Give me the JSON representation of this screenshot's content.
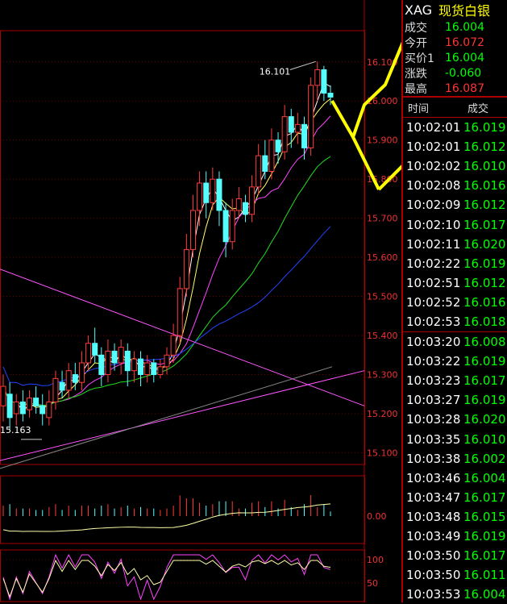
{
  "header": {
    "code": "XAG",
    "name": "现货白银"
  },
  "stats": [
    {
      "label": "成交",
      "value": "16.004",
      "color": "#00ff00"
    },
    {
      "label": "今开",
      "value": "16.072",
      "color": "#ff3333"
    },
    {
      "label": "买价1",
      "value": "16.004",
      "color": "#00ff00"
    },
    {
      "label": "涨跌",
      "value": "-0.060",
      "color": "#00ff00"
    },
    {
      "label": "最高",
      "value": "16.087",
      "color": "#ff3333"
    }
  ],
  "table": {
    "col_time": "时间",
    "col_price": "成交",
    "rows": [
      {
        "time": "10:02:01",
        "price": "16.019"
      },
      {
        "time": "10:02:01",
        "price": "16.012"
      },
      {
        "time": "10:02:02",
        "price": "16.010"
      },
      {
        "time": "10:02:08",
        "price": "16.016"
      },
      {
        "time": "10:02:09",
        "price": "16.012"
      },
      {
        "time": "10:02:10",
        "price": "16.017"
      },
      {
        "time": "10:02:11",
        "price": "16.020"
      },
      {
        "time": "10:02:22",
        "price": "16.019"
      },
      {
        "time": "10:02:51",
        "price": "16.012"
      },
      {
        "time": "10:02:52",
        "price": "16.016"
      },
      {
        "time": "10:02:53",
        "price": "16.018"
      },
      {
        "time": "10:03:20",
        "price": "16.008"
      },
      {
        "time": "10:03:22",
        "price": "16.019"
      },
      {
        "time": "10:03:23",
        "price": "16.017"
      },
      {
        "time": "10:03:27",
        "price": "16.019"
      },
      {
        "time": "10:03:28",
        "price": "16.020"
      },
      {
        "time": "10:03:35",
        "price": "16.010"
      },
      {
        "time": "10:03:38",
        "price": "16.002"
      },
      {
        "time": "10:03:46",
        "price": "16.004"
      },
      {
        "time": "10:03:47",
        "price": "16.017"
      },
      {
        "time": "10:03:48",
        "price": "16.015"
      },
      {
        "time": "10:03:49",
        "price": "16.019"
      },
      {
        "time": "10:03:50",
        "price": "16.017"
      },
      {
        "time": "10:03:50",
        "price": "16.011"
      },
      {
        "time": "10:03:53",
        "price": "16.004"
      }
    ]
  },
  "chart_data": {
    "type": "candlestick",
    "y_ticks": [
      "16.100",
      "16.000",
      "15.900",
      "15.800",
      "15.700",
      "15.600",
      "15.500",
      "15.400",
      "15.300",
      "15.200",
      "15.100"
    ],
    "ylim": [
      15.07,
      16.18
    ],
    "annotations": {
      "high": "16.101",
      "low": "15.163"
    },
    "candles": [
      [
        15.22,
        15.27,
        15.3,
        15.18
      ],
      [
        15.25,
        15.19,
        15.28,
        15.16
      ],
      [
        15.2,
        15.23,
        15.25,
        15.17
      ],
      [
        15.23,
        15.2,
        15.26,
        15.18
      ],
      [
        15.21,
        15.24,
        15.26,
        15.19
      ],
      [
        15.24,
        15.22,
        15.27,
        15.2
      ],
      [
        15.22,
        15.2,
        15.25,
        15.17
      ],
      [
        15.19,
        15.23,
        15.26,
        15.17
      ],
      [
        15.23,
        15.29,
        15.31,
        15.21
      ],
      [
        15.28,
        15.26,
        15.31,
        15.24
      ],
      [
        15.26,
        15.31,
        15.33,
        15.24
      ],
      [
        15.3,
        15.28,
        15.33,
        15.26
      ],
      [
        15.28,
        15.33,
        15.36,
        15.26
      ],
      [
        15.33,
        15.38,
        15.4,
        15.31
      ],
      [
        15.38,
        15.35,
        15.42,
        15.33
      ],
      [
        15.35,
        15.3,
        15.37,
        15.27
      ],
      [
        15.3,
        15.36,
        15.39,
        15.28
      ],
      [
        15.36,
        15.33,
        15.38,
        15.31
      ],
      [
        15.33,
        15.37,
        15.39,
        15.3
      ],
      [
        15.36,
        15.31,
        15.38,
        15.27
      ],
      [
        15.31,
        15.34,
        15.36,
        15.28
      ],
      [
        15.34,
        15.3,
        15.36,
        15.27
      ],
      [
        15.3,
        15.33,
        15.35,
        15.28
      ],
      [
        15.33,
        15.3,
        15.34,
        15.28
      ],
      [
        15.3,
        15.32,
        15.34,
        15.29
      ],
      [
        15.32,
        15.35,
        15.37,
        15.3
      ],
      [
        15.35,
        15.4,
        15.43,
        15.33
      ],
      [
        15.4,
        15.52,
        15.55,
        15.38
      ],
      [
        15.52,
        15.62,
        15.66,
        15.5
      ],
      [
        15.62,
        15.72,
        15.76,
        15.6
      ],
      [
        15.72,
        15.79,
        15.82,
        15.68
      ],
      [
        15.79,
        15.74,
        15.82,
        15.7
      ],
      [
        15.74,
        15.8,
        15.83,
        15.72
      ],
      [
        15.8,
        15.72,
        15.82,
        15.68
      ],
      [
        15.72,
        15.64,
        15.74,
        15.6
      ],
      [
        15.64,
        15.72,
        15.75,
        15.62
      ],
      [
        15.72,
        15.75,
        15.78,
        15.7
      ],
      [
        15.74,
        15.71,
        15.76,
        15.69
      ],
      [
        15.71,
        15.78,
        15.81,
        15.69
      ],
      [
        15.78,
        15.86,
        15.89,
        15.76
      ],
      [
        15.86,
        15.82,
        15.9,
        15.8
      ],
      [
        15.82,
        15.9,
        15.93,
        15.8
      ],
      [
        15.9,
        15.87,
        15.92,
        15.84
      ],
      [
        15.87,
        15.96,
        15.99,
        15.85
      ],
      [
        15.96,
        15.92,
        15.98,
        15.88
      ],
      [
        15.92,
        15.94,
        15.97,
        15.89
      ],
      [
        15.94,
        15.88,
        15.96,
        15.85
      ],
      [
        15.88,
        16.04,
        16.06,
        15.86
      ],
      [
        16.04,
        16.08,
        16.101,
        16.0
      ],
      [
        16.08,
        16.02,
        16.09,
        16.0
      ],
      [
        16.02,
        16.01,
        16.04,
        15.99
      ]
    ],
    "volume_tick": "0.00",
    "indicator_ticks": [
      "100",
      "50"
    ]
  }
}
